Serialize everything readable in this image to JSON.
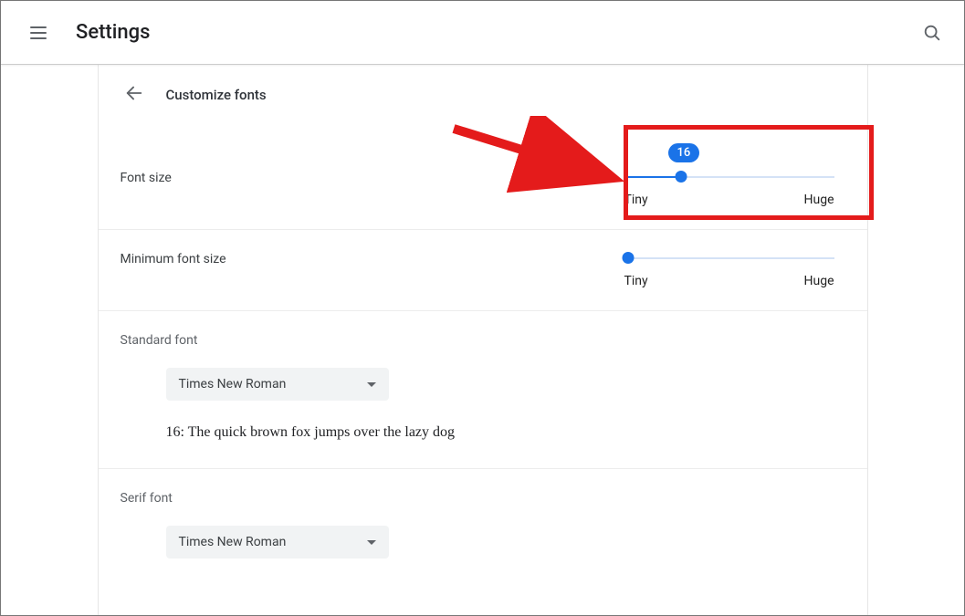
{
  "header": {
    "title": "Settings"
  },
  "subheader": {
    "title": "Customize fonts"
  },
  "fontSize": {
    "label": "Font size",
    "value": "16",
    "minLabel": "Tiny",
    "maxLabel": "Huge",
    "percent": 27
  },
  "minFontSize": {
    "label": "Minimum font size",
    "minLabel": "Tiny",
    "maxLabel": "Huge",
    "percent": 2
  },
  "standardFont": {
    "label": "Standard font",
    "selected": "Times New Roman",
    "preview": "16: The quick brown fox jumps over the lazy dog"
  },
  "serifFont": {
    "label": "Serif font",
    "selected": "Times New Roman"
  }
}
